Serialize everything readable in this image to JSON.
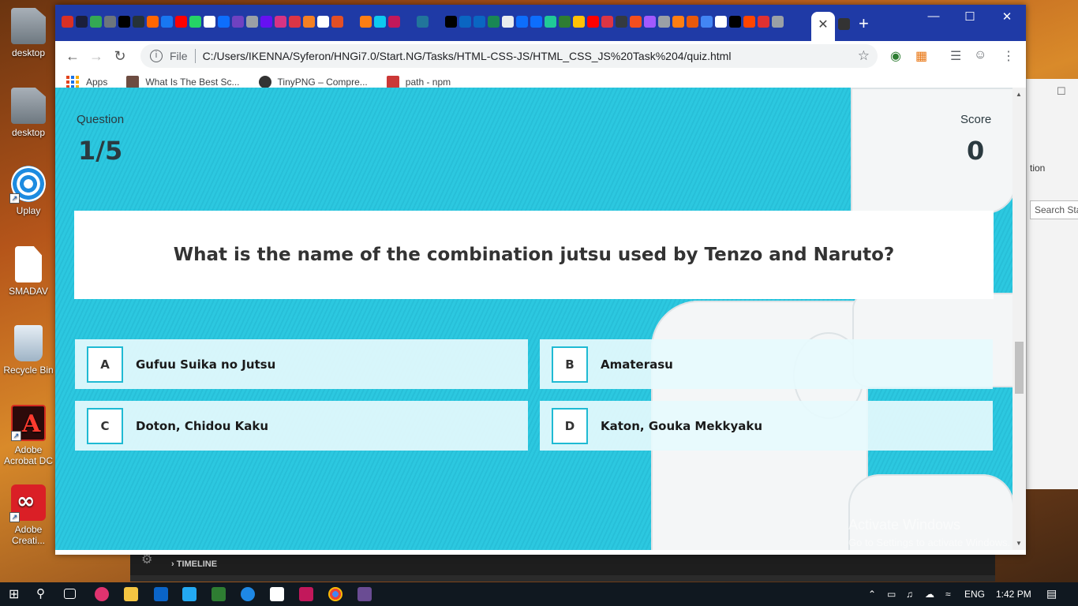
{
  "desktop": {
    "icons": [
      {
        "label": "desktop"
      },
      {
        "label": "desktop"
      },
      {
        "label": "Uplay"
      },
      {
        "label": "SMADAV"
      },
      {
        "label": "Recycle Bin"
      },
      {
        "label": "Adobe Acrobat DC"
      },
      {
        "label": "Adobe Creati..."
      }
    ]
  },
  "browser": {
    "address": {
      "file_label": "File",
      "url": "C:/Users/IKENNA/Syferon/HNGi7.0/Start.NG/Tasks/HTML-CSS-JS/HTML_CSS_JS%20Task%204/quiz.html"
    },
    "bookmarks": [
      {
        "label": "Apps"
      },
      {
        "label": "What Is The Best Sc..."
      },
      {
        "label": "TinyPNG – Compre..."
      },
      {
        "label": "path - npm"
      }
    ]
  },
  "quiz": {
    "question_label": "Question",
    "progress": "1/5",
    "score_label": "Score",
    "score": "0",
    "question": "What is the name of the combination jutsu used by Tenzo and Naruto?",
    "options": [
      {
        "letter": "A",
        "text": "Gufuu Suika no Jutsu"
      },
      {
        "letter": "B",
        "text": "Amaterasu"
      },
      {
        "letter": "C",
        "text": "Doton, Chidou Kaku"
      },
      {
        "letter": "D",
        "text": "Katon, Gouka Mekkyaku"
      }
    ]
  },
  "watermark": {
    "line1": "Activate Windows",
    "line2": "Go to Settings to activate Windows."
  },
  "background_app": {
    "panel_title": "TIMELINE",
    "right_panel_text": "tion",
    "right_panel_search": "Search Sta..."
  },
  "taskbar": {
    "language": "ENG",
    "time": "1:42 PM"
  },
  "colors": {
    "tab_strip": "#1f3aa6",
    "page_background": "#2bc5de",
    "option_border": "#1fbad3"
  }
}
